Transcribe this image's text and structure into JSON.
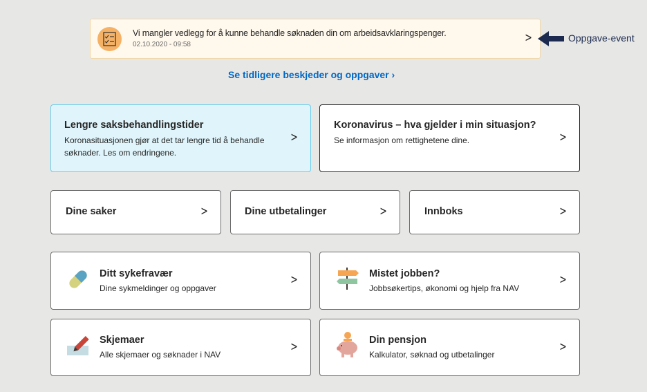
{
  "notification": {
    "title": "Vi mangler vedlegg for å kunne behandle søknaden din om arbeidsavklaringspenger.",
    "date": "02.10.2020 - 09:58",
    "icon": "checklist-icon",
    "accent": "#f5b266"
  },
  "annotation": {
    "label": "Oppgave-event",
    "color": "#1b2a4e"
  },
  "history_link": "Se tidligere beskjeder og oppgaver",
  "info_cards": [
    {
      "title": "Lengre saksbehandlingstider",
      "subtitle": "Koronasituasjonen gjør at det tar lengre tid å behandle søknader. Les om endringene."
    },
    {
      "title": "Koronavirus – hva gjelder i min situasjon?",
      "subtitle": "Se informasjon om rettighetene dine."
    }
  ],
  "nav_cards": [
    {
      "title": "Dine saker"
    },
    {
      "title": "Dine utbetalinger"
    },
    {
      "title": "Innboks"
    }
  ],
  "service_cards": [
    {
      "title": "Ditt sykefravær",
      "subtitle": "Dine sykmeldinger og oppgaver",
      "icon": "pill-icon"
    },
    {
      "title": "Mistet jobben?",
      "subtitle": "Jobbsøkertips, økonomi og hjelp fra NAV",
      "icon": "signpost-icon"
    },
    {
      "title": "Skjemaer",
      "subtitle": "Alle skjemaer og søknader i NAV",
      "icon": "pencil-form-icon"
    },
    {
      "title": "Din pensjon",
      "subtitle": "Kalkulator, søknad og utbetalinger",
      "icon": "piggy-bank-icon"
    }
  ]
}
